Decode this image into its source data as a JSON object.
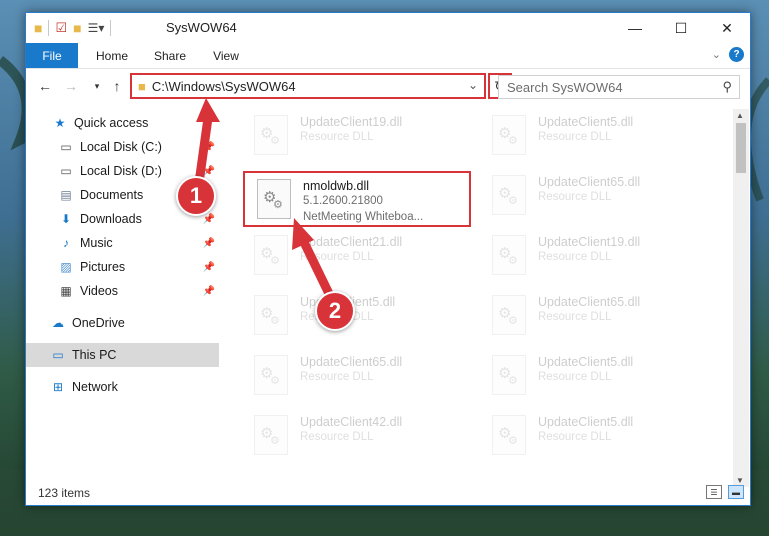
{
  "window": {
    "title": "SysWOW64"
  },
  "ribbon": {
    "tabs": [
      "File",
      "Home",
      "Share",
      "View"
    ],
    "help": "?"
  },
  "address": {
    "path": "C:\\Windows\\SysWOW64"
  },
  "search": {
    "placeholder": "Search SysWOW64"
  },
  "sidebar": {
    "items": [
      {
        "label": "Quick access",
        "icon": "star-icon"
      },
      {
        "label": "Local Disk (C:)",
        "icon": "drive-icon"
      },
      {
        "label": "Local Disk (D:)",
        "icon": "drive-icon"
      },
      {
        "label": "Documents",
        "icon": "documents-icon"
      },
      {
        "label": "Downloads",
        "icon": "download-icon"
      },
      {
        "label": "Music",
        "icon": "music-icon"
      },
      {
        "label": "Pictures",
        "icon": "pictures-icon"
      },
      {
        "label": "Videos",
        "icon": "videos-icon"
      },
      {
        "label": "OneDrive",
        "icon": "cloud-icon"
      },
      {
        "label": "This PC",
        "icon": "computer-icon"
      },
      {
        "label": "Network",
        "icon": "network-icon"
      }
    ]
  },
  "files": {
    "highlighted": {
      "name": "nmoldwb.dll",
      "version": "5.1.2600.21800",
      "description": "NetMeeting Whiteboa..."
    },
    "faded": [
      {
        "name": "UpdateClient19.dll",
        "type": "Resource DLL"
      },
      {
        "name": "UpdateClient5.dll",
        "type": "Resource DLL"
      },
      {
        "name": "UpdateClient65.dll",
        "type": "Resource DLL"
      },
      {
        "name": "UpdateClient21.dll",
        "type": "Resource DLL"
      },
      {
        "name": "UpdateClient19.dll",
        "type": "Resource DLL"
      },
      {
        "name": "UpdateClient5.dll",
        "type": "Resource DLL"
      },
      {
        "name": "UpdateClient65.dll",
        "type": "Resource DLL"
      },
      {
        "name": "UpdateClient65.dll",
        "type": "Resource DLL"
      },
      {
        "name": "UpdateClient5.dll",
        "type": "Resource DLL"
      },
      {
        "name": "UpdateClient42.dll",
        "type": "Resource DLL"
      },
      {
        "name": "UpdateClient5.dll",
        "type": "Resource DLL"
      }
    ]
  },
  "status": {
    "count": "123 items"
  },
  "callouts": [
    "1",
    "2"
  ],
  "colors": {
    "accent": "#1979ca",
    "highlight_red": "#d9333a"
  }
}
